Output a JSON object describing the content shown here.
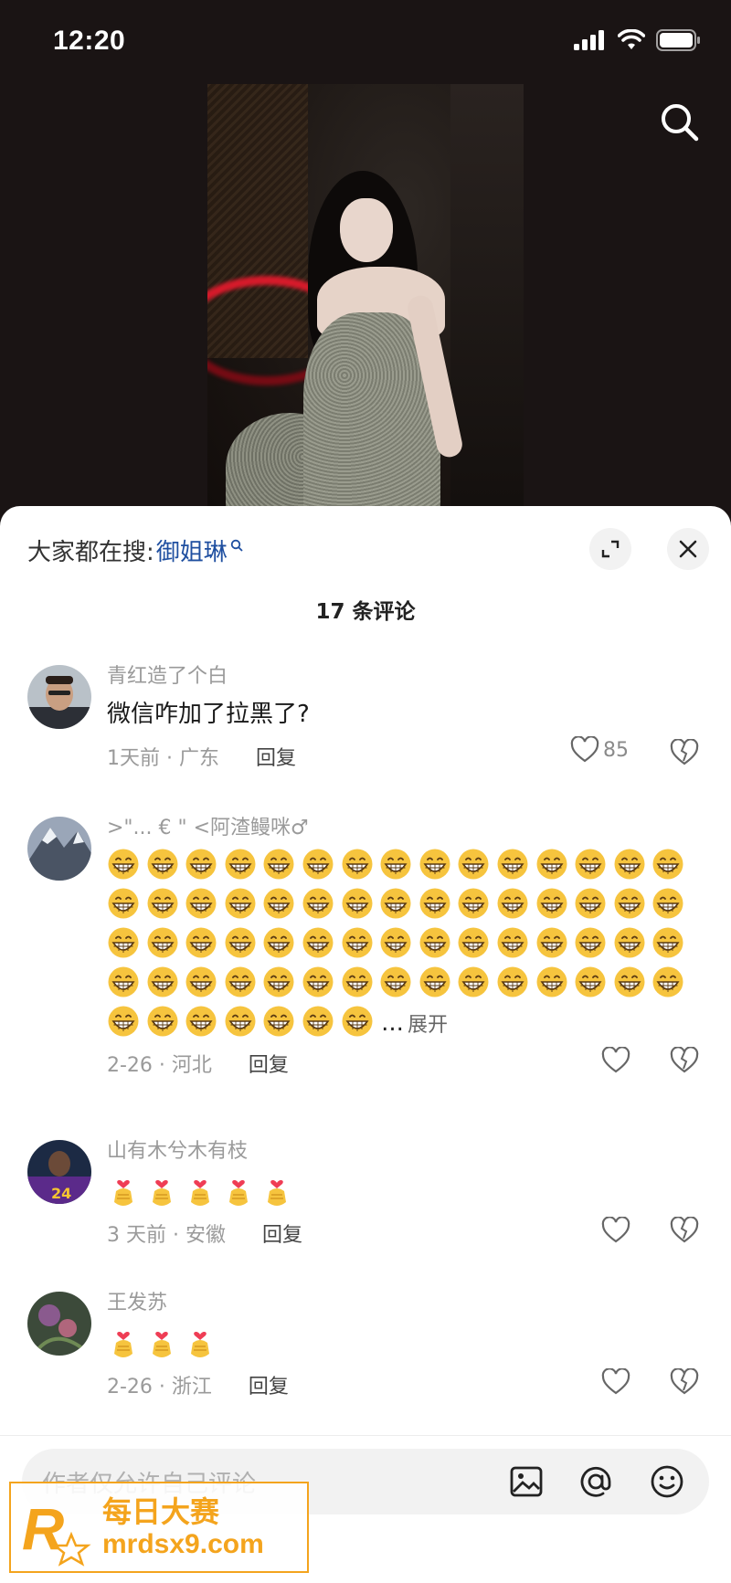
{
  "status_bar": {
    "time": "12:20"
  },
  "search_bar": {
    "prefix": "大家都在搜:",
    "keyword": "御姐琳"
  },
  "comments_header": {
    "count_label": "17 条评论"
  },
  "comments": [
    {
      "username": "青红造了个白",
      "text": "微信咋加了拉黑了?",
      "time": "1天前 · 广东",
      "reply": "回复",
      "likes": "85"
    },
    {
      "username": ">\"...   € \" <阿渣鳗咪♂",
      "emoji": "grinning-face",
      "emoji_count": 67,
      "ellipsis": "...",
      "expand": "展开",
      "time": "2-26 · 河北",
      "reply": "回复"
    },
    {
      "username": "山有木兮木有枝",
      "emoji": "finger-heart-hand",
      "emoji_count": 5,
      "time": "3 天前 · 安徽",
      "reply": "回复"
    },
    {
      "username": "王发苏",
      "emoji": "finger-heart-hand",
      "emoji_count": 3,
      "time": "2-26 · 浙江",
      "reply": "回复"
    }
  ],
  "input_bar": {
    "placeholder": "作者仅允许自己评论"
  },
  "watermark": {
    "logo_letter": "R",
    "title": "每日大赛",
    "url": "mrdsx9.com"
  },
  "colors": {
    "accent_keyword": "#1f4fa0",
    "watermark": "#f4a41d",
    "emoji_face": "#f6c43e"
  }
}
